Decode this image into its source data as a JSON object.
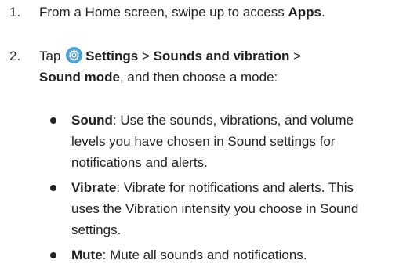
{
  "steps": [
    {
      "number": "1.",
      "prefix": "From a Home screen, swipe up to access ",
      "bold": "Apps",
      "suffix": "."
    },
    {
      "number": "2.",
      "tap": "Tap",
      "icon": "settings-gear-icon",
      "path1": "Settings",
      "sep1": " > ",
      "path2": "Sounds and vibration",
      "sep2": " >",
      "path3": "Sound mode",
      "suffix": ", and then choose a mode:"
    }
  ],
  "modes": [
    {
      "name": "Sound",
      "line1": ": Use the sounds, vibrations, and volume",
      "line2": "levels you have chosen in Sound settings for",
      "line3": "notifications and alerts."
    },
    {
      "name": "Vibrate",
      "line1": ": Vibrate for notifications and alerts. This",
      "line2": "uses the Vibration intensity you choose in Sound",
      "line3": "settings."
    },
    {
      "name": "Mute",
      "line1": ": Mute all sounds and notifications."
    }
  ],
  "colors": {
    "text": "#222222",
    "icon_bg": "#4aa0d6"
  }
}
